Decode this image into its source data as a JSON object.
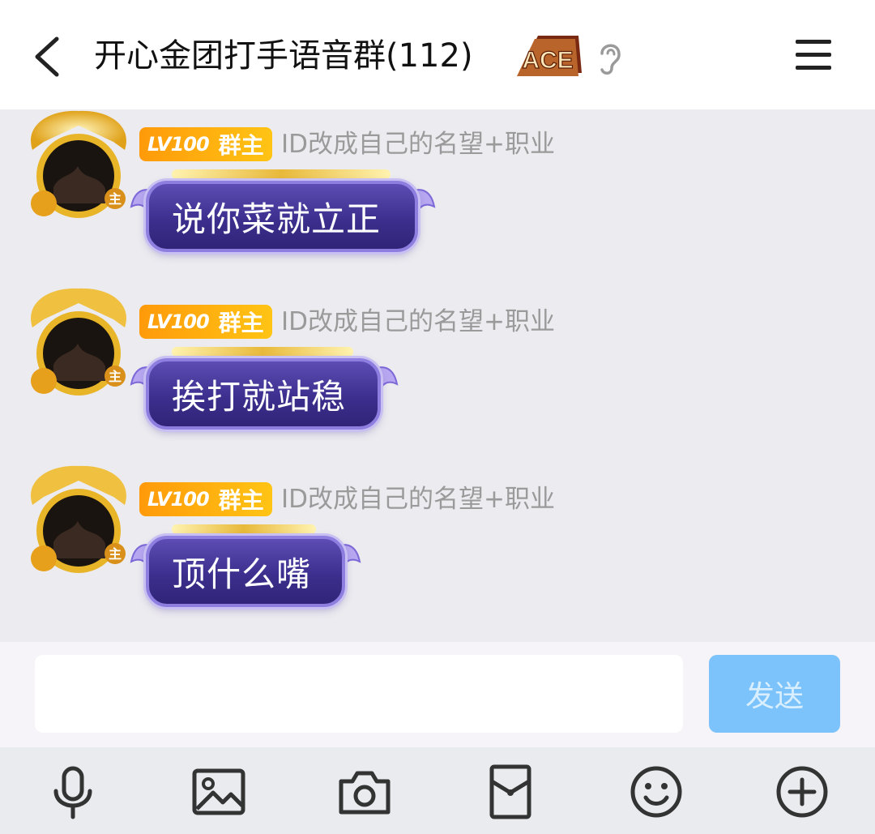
{
  "header": {
    "title": "开心金团打手语音群(112)",
    "ace_label": "ACE"
  },
  "messages": [
    {
      "level": "LV100",
      "role": "群主",
      "nickname": "ID改成自己的名望+职业",
      "text": "说你菜就立正"
    },
    {
      "level": "LV100",
      "role": "群主",
      "nickname": "ID改成自己的名望+职业",
      "text": "挨打就站稳"
    },
    {
      "level": "LV100",
      "role": "群主",
      "nickname": "ID改成自己的名望+职业",
      "text": "顶什么嘴"
    }
  ],
  "composer": {
    "placeholder": "",
    "send_label": "发送"
  },
  "toolbar": {
    "items": [
      "microphone-icon",
      "image-icon",
      "camera-icon",
      "red-packet-icon",
      "emoji-icon",
      "plus-icon"
    ]
  },
  "colors": {
    "badge": "#ff9a0a",
    "bubble": "#3c2f8e",
    "send_button": "#7cc3fb"
  },
  "avatar_badge": "主"
}
